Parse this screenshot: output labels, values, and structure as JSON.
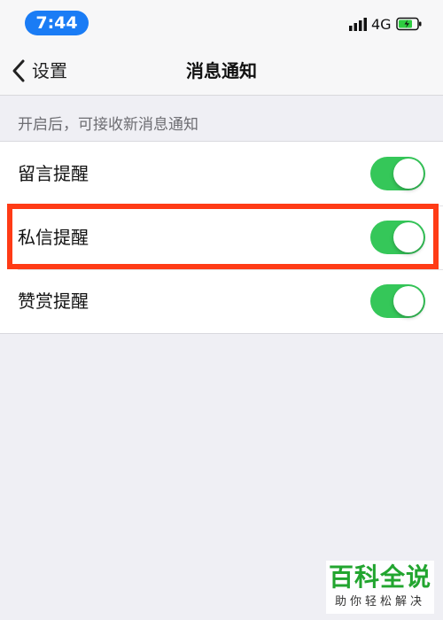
{
  "status_bar": {
    "time": "7:44",
    "network": "4G",
    "battery_color": "#2ecc40"
  },
  "nav": {
    "back_label": "设置",
    "title": "消息通知"
  },
  "section": {
    "header": "开启后，可接收新消息通知"
  },
  "rows": [
    {
      "label": "留言提醒",
      "enabled": true
    },
    {
      "label": "私信提醒",
      "enabled": true
    },
    {
      "label": "赞赏提醒",
      "enabled": true
    }
  ],
  "colors": {
    "toggle_on": "#35c759",
    "highlight": "#ff3b16",
    "time_pill": "#1a7cf5",
    "watermark": "#22a52f"
  },
  "watermark": {
    "main": "百科全说",
    "sub": "助你轻松解决"
  }
}
